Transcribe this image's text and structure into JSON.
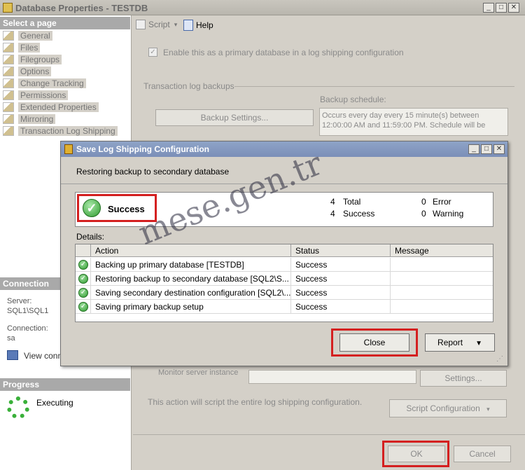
{
  "outer_window": {
    "title": "Database Properties - TESTDB"
  },
  "left_pane": {
    "select_page_header": "Select a page",
    "pages": [
      "General",
      "Files",
      "Filegroups",
      "Options",
      "Change Tracking",
      "Permissions",
      "Extended Properties",
      "Mirroring",
      "Transaction Log Shipping"
    ],
    "connection_header": "Connection",
    "server_label": "Server:",
    "server_value": "SQL1\\SQL1",
    "connection_label": "Connection:",
    "connection_value": "sa",
    "view_connection": "View conn",
    "progress_header": "Progress",
    "progress_status": "Executing"
  },
  "toolbar": {
    "script_label": "Script",
    "help_label": "Help"
  },
  "main": {
    "enable_checkbox_label": "Enable this as a primary database in a log shipping configuration",
    "tlog_backups_label": "Transaction log backups",
    "backup_schedule_label": "Backup schedule:",
    "backup_settings_button": "Backup Settings...",
    "schedule_text": "Occurs every day every 15 minute(s) between 12:00:00 AM and 11:59:00 PM. Schedule will be",
    "monitor_label": "Monitor server instance",
    "settings_button": "Settings...",
    "script_note": "This action will script the entire log shipping configuration.",
    "script_config_button": "Script Configuration",
    "ok_button": "OK",
    "cancel_button": "Cancel"
  },
  "dialog": {
    "title": "Save Log Shipping Configuration",
    "subtitle": "Restoring backup to secondary database",
    "status": "Success",
    "total_count": "4",
    "total_label": "Total",
    "success_count": "4",
    "success_label": "Success",
    "error_count": "0",
    "error_label": "Error",
    "warning_count": "0",
    "warning_label": "Warning",
    "details_label": "Details:",
    "columns": [
      "Action",
      "Status",
      "Message"
    ],
    "rows": [
      {
        "action": "Backing up primary database [TESTDB]",
        "status": "Success",
        "message": ""
      },
      {
        "action": "Restoring backup to secondary database [SQL2\\S...",
        "status": "Success",
        "message": ""
      },
      {
        "action": "Saving secondary destination configuration [SQL2\\...",
        "status": "Success",
        "message": ""
      },
      {
        "action": "Saving primary backup setup",
        "status": "Success",
        "message": ""
      }
    ],
    "close_button": "Close",
    "report_button": "Report"
  },
  "watermark": "mese.gen.tr",
  "colors": {
    "highlight_red": "#d42020",
    "success_green": "#2e9a2e",
    "dialog_title": "#7b8fb8"
  }
}
